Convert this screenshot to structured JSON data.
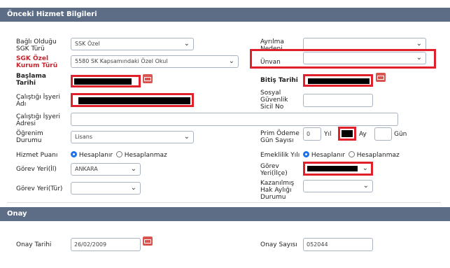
{
  "sections": {
    "previous_service": "Önceki Hizmet Bilgileri",
    "approval": "Onay"
  },
  "left": {
    "sgk_type": {
      "label": "Bağlı Olduğu SGK Türü",
      "value": "SSK Özel"
    },
    "sgk_institution": {
      "label": "SGK Özel Kurum Türü",
      "value": "5580 SK Kapsamındaki Özel Okul"
    },
    "start_date": {
      "label": "Başlama Tarihi"
    },
    "employer_name": {
      "label": "Çalıştığı İşyeri Adı"
    },
    "employer_address": {
      "label": "Çalıştığı İşyeri Adresi",
      "value": ""
    },
    "education": {
      "label": "Öğrenim Durumu",
      "value": "Lisans"
    },
    "service_points": {
      "label": "Hizmet Puanı",
      "opt1": "Hesaplanır",
      "opt2": "Hesaplanmaz",
      "selected": "Hesaplanır"
    },
    "duty_province": {
      "label": "Görev Yeri(İl)",
      "value": "ANKARA"
    },
    "duty_type": {
      "label": "Görev Yeri(Tür)",
      "value": ""
    }
  },
  "right": {
    "separation_reason": {
      "label": "Ayrılma Nedeni",
      "value": ""
    },
    "title": {
      "label": "Ünvan",
      "value": ""
    },
    "end_date": {
      "label": "Bitiş Tarihi"
    },
    "ssn": {
      "label": "Sosyal Güvenlik Sicil No",
      "value": ""
    },
    "premium_days": {
      "label": "Prim Ödeme Gün Sayısı",
      "year_value": "0",
      "year_label": "Yıl",
      "month_label": "Ay",
      "day_value": "",
      "day_label": "Gün"
    },
    "retirement_year": {
      "label": "Emeklilik Yılı",
      "opt1": "Hesaplanır",
      "opt2": "Hesaplanmaz",
      "selected": "Hesaplanır"
    },
    "duty_district": {
      "label": "Görev Yeri(İlçe)"
    },
    "earned_salary": {
      "label": "Kazanılmış Hak Aylığı Durumu",
      "value": ""
    }
  },
  "approval": {
    "date": {
      "label": "Onay Tarihi",
      "value": "26/02/2009"
    },
    "number": {
      "label": "Onay Sayısı",
      "value": "052044"
    }
  },
  "colors": {
    "header": "#5d6d86",
    "label_red": "#c0262e",
    "highlight": "#e0202a",
    "calendar": "#d9534f",
    "radio": "#1a73e8"
  },
  "icons": {
    "dropdown": "chevron-down-icon",
    "calendar": "calendar-icon"
  }
}
